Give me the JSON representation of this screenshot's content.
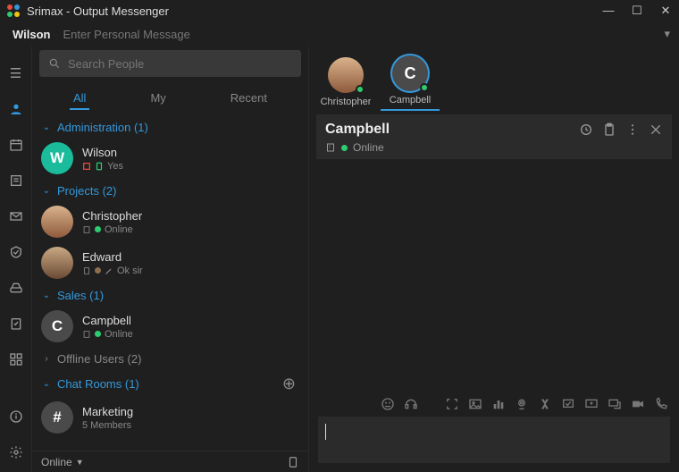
{
  "window": {
    "title": "Srimax - Output Messenger"
  },
  "profile": {
    "name": "Wilson",
    "personal_message_placeholder": "Enter Personal Message"
  },
  "search": {
    "placeholder": "Search People"
  },
  "tabs": {
    "all": "All",
    "my": "My",
    "recent": "Recent"
  },
  "groups": [
    {
      "label": "Administration (1)"
    },
    {
      "label": "Projects (2)"
    },
    {
      "label": "Sales (1)"
    },
    {
      "label": "Offline Users (2)"
    },
    {
      "label": "Chat Rooms (1)"
    }
  ],
  "contacts": {
    "wilson": {
      "name": "Wilson",
      "sub": "Yes",
      "initial": "W",
      "color": "#1abc9c"
    },
    "christopher": {
      "name": "Christopher",
      "sub": "Online",
      "color": "#8e5a3c"
    },
    "edward": {
      "name": "Edward",
      "sub": "Ok sir",
      "color": "#7a5c47"
    },
    "campbell": {
      "name": "Campbell",
      "sub": "Online",
      "initial": "C",
      "color": "#4a4a4a"
    },
    "marketing": {
      "name": "Marketing",
      "sub": "5 Members",
      "initial": "#",
      "color": "#4a4a4a"
    }
  },
  "status": {
    "label": "Online"
  },
  "chat_tabs": {
    "christopher": {
      "label": "Christopher"
    },
    "campbell": {
      "label": "Campbell",
      "initial": "C",
      "color": "#4a4a4a"
    }
  },
  "chat_header": {
    "title": "Campbell",
    "status": "Online"
  }
}
